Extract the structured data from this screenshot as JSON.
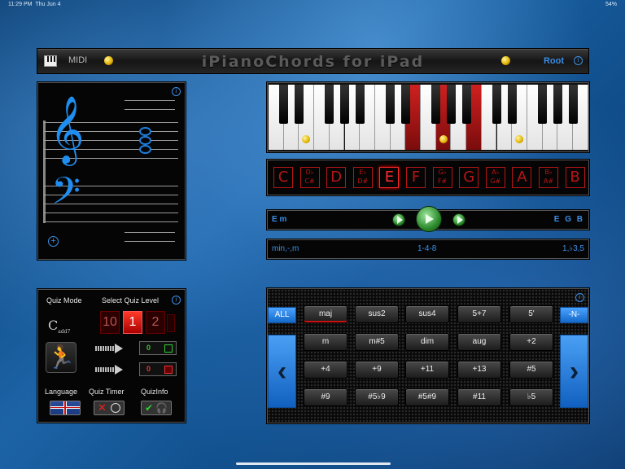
{
  "status": {
    "time": "11:29 PM",
    "date": "Thu Jun 4",
    "battery": "54%"
  },
  "titlebar": {
    "midi": "MIDI",
    "title": "iPianoChords for iPad",
    "root": "Root"
  },
  "keyboard": {
    "white_keys": 21,
    "highlighted": [
      "E",
      "G",
      "B"
    ]
  },
  "note_buttons": [
    "C",
    "D♭|C#",
    "D",
    "E♭|D#",
    "E",
    "F",
    "G♭|F#",
    "G",
    "A♭|G#",
    "A",
    "B♭|A#",
    "B"
  ],
  "selected_note": "E",
  "chord": {
    "name": "E m",
    "notes": "E G B"
  },
  "info": {
    "aliases": "min,-,m",
    "intervals": "1-4-8",
    "formula": "1,♭3,5"
  },
  "quiz": {
    "mode_label": "Quiz Mode",
    "level_label": "Select Quiz Level",
    "levels": [
      "10",
      "1",
      "2"
    ],
    "selected_level": "1",
    "correct": "0",
    "wrong": "0",
    "language_label": "Language",
    "timer_label": "Quiz Timer",
    "quizinfo_label": "QuizInfo"
  },
  "chord_types": {
    "all_label": "ALL",
    "n_label": "-N-",
    "rows": [
      [
        "maj",
        "sus2",
        "sus4",
        "5+7",
        "5'"
      ],
      [
        "m",
        "m#5",
        "dim",
        "aug",
        "+2"
      ],
      [
        "+4",
        "+9",
        "+11",
        "+13",
        "#5"
      ],
      [
        "#9",
        "#5♭9",
        "#5#9",
        "#11",
        "♭5"
      ]
    ],
    "selected": "maj"
  },
  "colors": {
    "accent": "#3b8fe6",
    "note_red": "#b71515",
    "key_red": "#cf2020"
  }
}
